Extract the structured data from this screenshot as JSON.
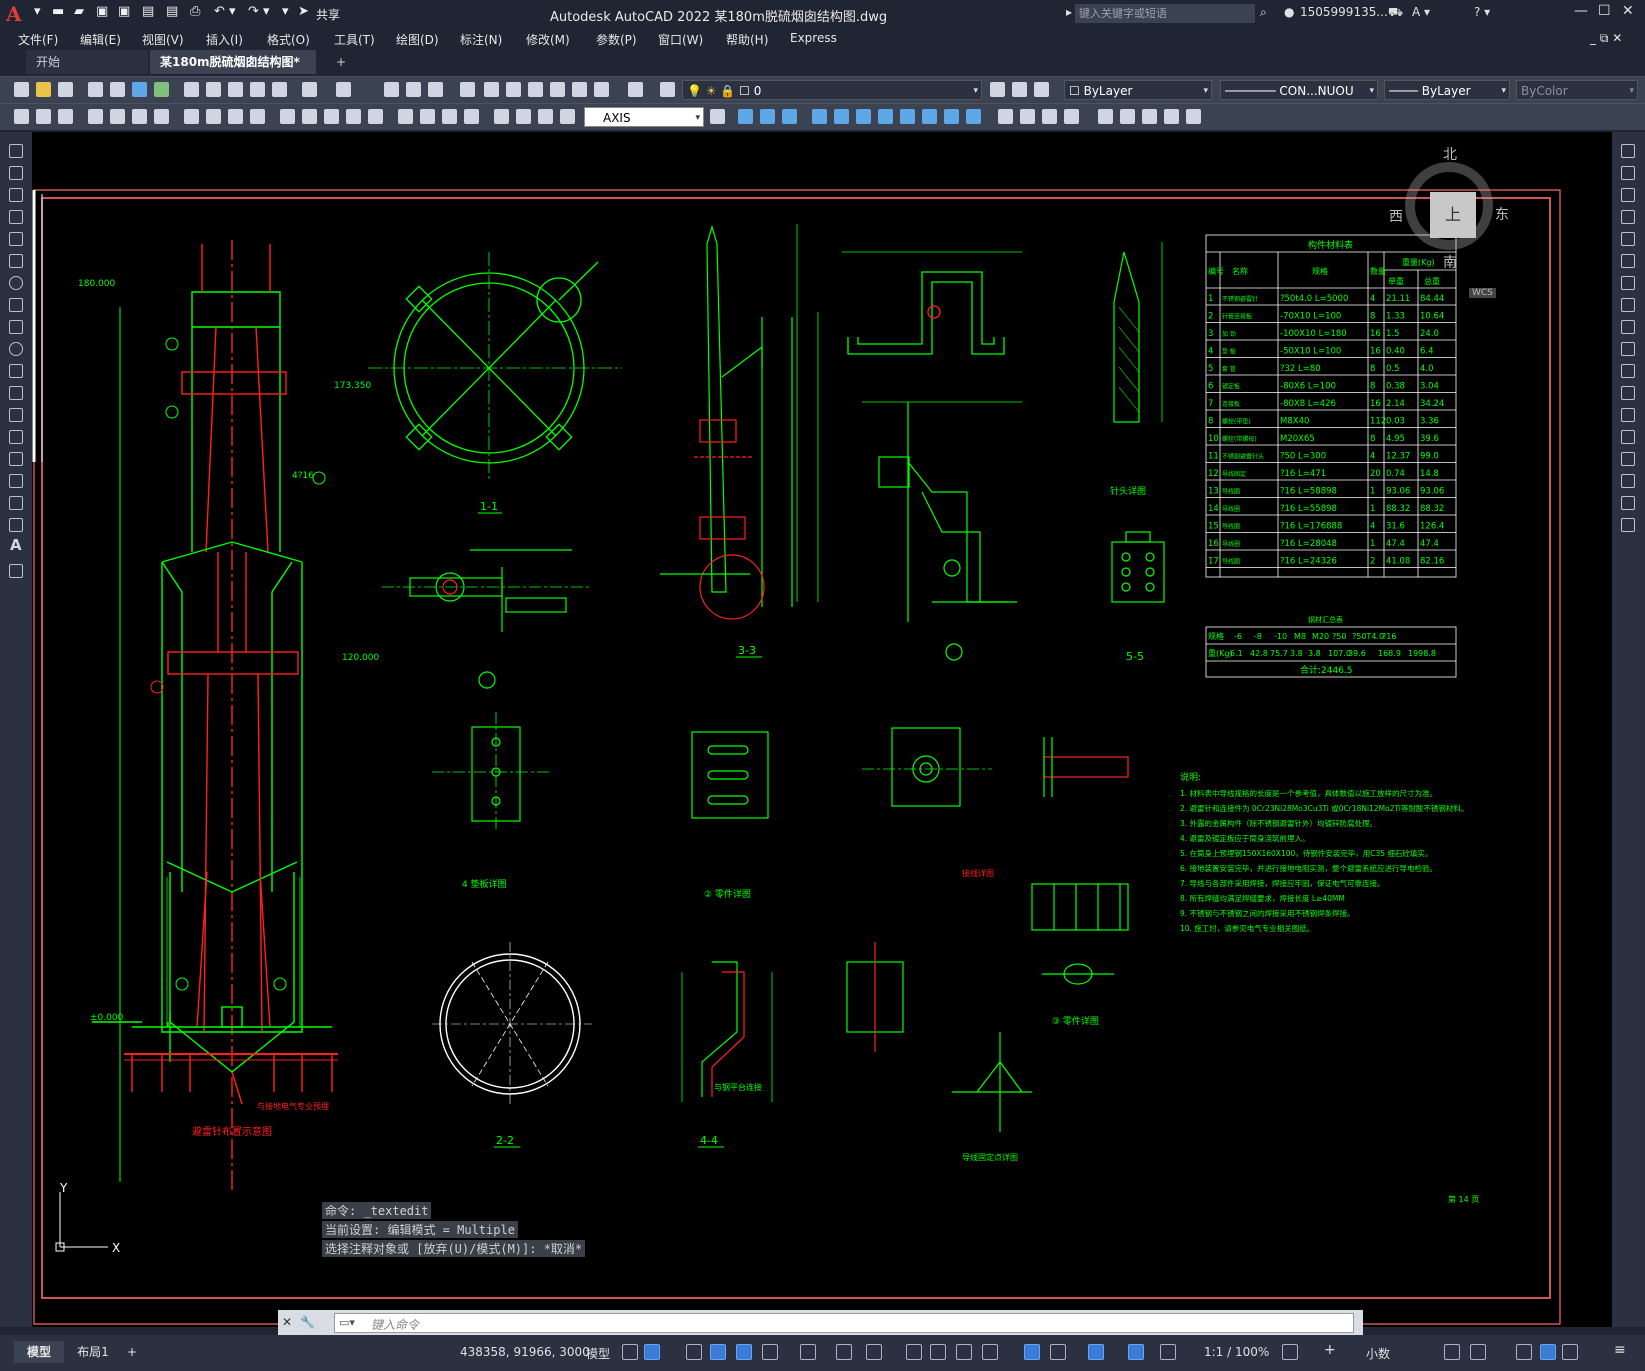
{
  "window": {
    "title": "Autodesk AutoCAD 2022    某180m脱硫烟囱结构图.dwg",
    "search_placeholder": "键入关键字或短语",
    "user": "1505999135...",
    "share": "共享",
    "logo": "A"
  },
  "menu": [
    "文件(F)",
    "编辑(E)",
    "视图(V)",
    "插入(I)",
    "格式(O)",
    "工具(T)",
    "绘图(D)",
    "标注(N)",
    "修改(M)",
    "参数(P)",
    "窗口(W)",
    "帮助(H)",
    "Express"
  ],
  "tabs": [
    {
      "label": "开始",
      "active": false
    },
    {
      "label": "某180m脱硫烟囱结构图*",
      "active": true
    }
  ],
  "toolbar": {
    "layer": "0",
    "color": "ByLayer",
    "linetype": "CON...NUOU",
    "lineweight": "ByLayer",
    "plotstyle": "ByColor",
    "dimstyle": "AXIS"
  },
  "viewcube": {
    "north": "北",
    "south": "南",
    "east": "东",
    "west": "西",
    "top": "上",
    "wcs": "WCS"
  },
  "drawing": {
    "views": [
      "1-1",
      "3-3",
      "5-5",
      "2-2",
      "4-4"
    ],
    "labels": {
      "base_plan": "避雷针布置示意图",
      "tip_detail": "针头详图",
      "part_detail_4": "4 垫板详图",
      "part_detail_2": "② 零件详图",
      "part_detail_3": "③ 零件详图",
      "wire_detail": "导线固定点详图",
      "support_detail": "接线详图",
      "electrode_note": "与接地电气专业预埋",
      "elev1": "173.350",
      "elev2": "120.000",
      "elev3": "±0.000",
      "elev4": "180.000",
      "rebar": "4?16",
      "platform": "与钢平台连接",
      "sheet": "第 14 页"
    },
    "notes_title": "说明:",
    "notes": [
      "1. 材料表中导线规格的长度是一个参考值，具体数值以施工放样的尺寸为准。",
      "2. 避雷针和连接件为 0Cr23Ni28Mo3Cu3Ti 或0Cr18Ni12Mo2Ti等耐酸不锈钢材料。",
      "3. 外露的金属构件（除不锈钢避雷针外）均镀锌防腐处理。",
      "4. 避雷及镀定板应于筒身浇筑前埋入。",
      "5. 在筒身上预埋钢150X160X100，待钢件安装完毕，用C35 细石砼填实。",
      "6. 接地装置安装完毕，并进行接地电阻实测，整个避雷系统应进行导电检验。",
      "7. 导线与各部件采用焊接，焊接应牢固，保证电气可靠连接。",
      "8. 所有焊缝均满足焊缝要求，焊接长度 L≥40MM",
      "9. 不锈钢与不锈钢之间的焊接采用不锈钢焊条焊接。",
      "10. 施工时，请参见电气专业相关图纸。"
    ],
    "material_table": {
      "title": "构件材料表",
      "headers": [
        "编号",
        "名称",
        "规格",
        "数量",
        "单重",
        "总重"
      ],
      "weight_header": "重量(Kg)",
      "rows": [
        [
          "1",
          "不锈钢避雷针",
          "?50t4.0 L=5000",
          "4",
          "21.11",
          "84.44"
        ],
        [
          "2",
          "针管连接板",
          "-70X10 L=100",
          "8",
          "1.33",
          "10.64"
        ],
        [
          "3",
          "加 劲",
          "-100X10 L=180",
          "16",
          "1.5",
          "24.0"
        ],
        [
          "4",
          "垫 板",
          "-50X10 L=100",
          "16",
          "0.40",
          "6.4"
        ],
        [
          "5",
          "套 管",
          "?32 L=80",
          "8",
          "0.5",
          "4.0"
        ],
        [
          "6",
          "镀定板",
          "-80X6 L=100",
          "8",
          "0.38",
          "3.04"
        ],
        [
          "7",
          "连接板",
          "-80X8 L=426",
          "16",
          "2.14",
          "34.24"
        ],
        [
          "8",
          "螺栓(带垫)",
          "M8X40",
          "112",
          "0.03",
          "3.36"
        ],
        [
          "10",
          "螺栓(带螺母)",
          "M20X65",
          "8",
          "4.95",
          "39.6"
        ],
        [
          "11",
          "不锈钢避雷针头",
          "?50 L=300",
          "4",
          "12.37",
          "99.0"
        ],
        [
          "12",
          "导线固定",
          "?16 L=471",
          "20",
          "0.74",
          "14.8"
        ],
        [
          "13",
          "导线圈",
          "?16 L=58898",
          "1",
          "93.06",
          "93.06"
        ],
        [
          "14",
          "导线圈",
          "?16 L=55898",
          "1",
          "88.32",
          "88.32"
        ],
        [
          "15",
          "导线圈",
          "?16 L=176888",
          "4",
          "31.6",
          "126.4"
        ],
        [
          "16",
          "导线圈",
          "?16 L=28048",
          "1",
          "47.4",
          "47.4"
        ],
        [
          "17",
          "导线圈",
          "?16 L=24326",
          "2",
          "41.08",
          "82.16"
        ]
      ]
    },
    "steel_table": {
      "title": "钢材汇总表",
      "headers": [
        "规格",
        "-6",
        "-8",
        "-10",
        "M8",
        "M20",
        "?50",
        "?50T4.0",
        "?16"
      ],
      "row": [
        "重(Kg)",
        "6.1",
        "42.8",
        "75.7",
        "3.8",
        "3.8",
        "107.0",
        "39.6",
        "168.9",
        "1998.8"
      ],
      "total": "合计:2446.5"
    }
  },
  "command": {
    "history": [
      "命令: _textedit",
      "当前设置: 编辑模式 = Multiple",
      "选择注释对象或 [放弃(U)/模式(M)]: *取消*"
    ],
    "placeholder": "键入命令"
  },
  "layout_tabs": [
    "模型",
    "布局1"
  ],
  "status": {
    "coords": "438358, 91966, 3000",
    "space": "模型",
    "scale": "1:1 / 100%",
    "units": "小数"
  },
  "colors": {
    "background": "#000000",
    "green": "#00ff00",
    "red": "#ff2020",
    "frame": "#ff6b6b",
    "ui": "#1f2533"
  }
}
